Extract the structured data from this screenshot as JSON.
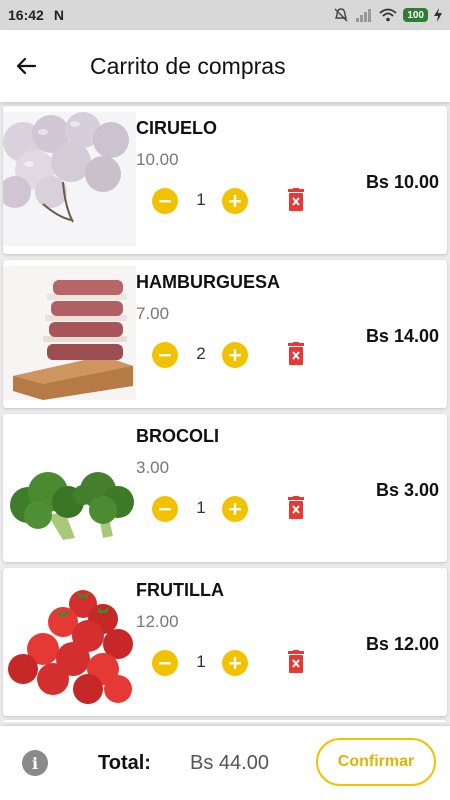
{
  "status_bar": {
    "time": "16:42",
    "notification_letter": "N",
    "battery": "100"
  },
  "app_bar": {
    "title": "Carrito de compras",
    "back_icon": "arrow-left-icon"
  },
  "cart": {
    "items": [
      {
        "name": "CIRUELO",
        "price": "10.00",
        "quantity": "1",
        "total": "Bs 10.00",
        "image": "cherries"
      },
      {
        "name": "HAMBURGUESA",
        "price": "7.00",
        "quantity": "2",
        "total": "Bs 14.00",
        "image": "burger-patties"
      },
      {
        "name": "BROCOLI",
        "price": "3.00",
        "quantity": "1",
        "total": "Bs 3.00",
        "image": "broccoli"
      },
      {
        "name": "FRUTILLA",
        "price": "12.00",
        "quantity": "1",
        "total": "Bs 12.00",
        "image": "strawberries"
      }
    ]
  },
  "footer": {
    "total_label": "Total:",
    "total_value": "Bs 44.00",
    "confirm_label": "Confirmar"
  },
  "colors": {
    "accent": "#f2c200",
    "delete": "#e53935"
  }
}
